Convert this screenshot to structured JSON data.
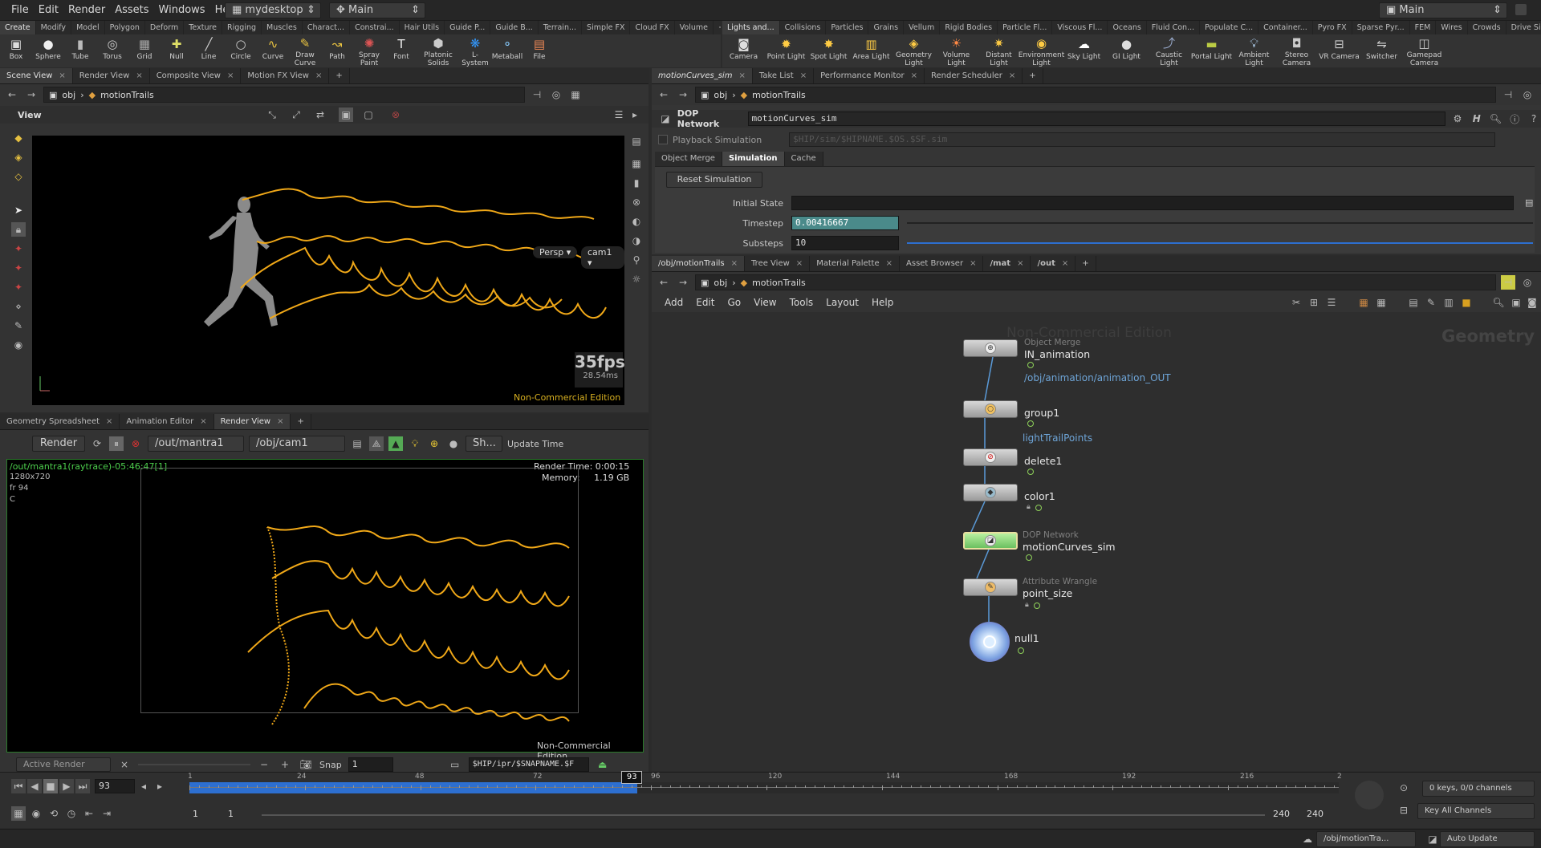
{
  "menubar": {
    "items": [
      "File",
      "Edit",
      "Render",
      "Assets",
      "Windows",
      "Help"
    ],
    "desktop": "mydesktop",
    "context": "Main",
    "right_context": "Main"
  },
  "shelf_left": {
    "tabs": [
      "Create",
      "Modify",
      "Model",
      "Polygon",
      "Deform",
      "Texture",
      "Rigging",
      "Muscles",
      "Charact...",
      "Constrai...",
      "Hair Utils",
      "Guide P...",
      "Guide B...",
      "Terrain...",
      "Simple FX",
      "Cloud FX",
      "Volume"
    ],
    "tools": [
      {
        "label": "Box",
        "icon": "box-icon"
      },
      {
        "label": "Sphere",
        "icon": "sphere-icon"
      },
      {
        "label": "Tube",
        "icon": "tube-icon"
      },
      {
        "label": "Torus",
        "icon": "torus-icon"
      },
      {
        "label": "Grid",
        "icon": "grid-icon"
      },
      {
        "label": "Null",
        "icon": "null-icon"
      },
      {
        "label": "Line",
        "icon": "line-icon"
      },
      {
        "label": "Circle",
        "icon": "circle-icon"
      },
      {
        "label": "Curve",
        "icon": "curve-icon"
      },
      {
        "label": "Draw Curve",
        "icon": "draw-curve-icon"
      },
      {
        "label": "Path",
        "icon": "path-icon"
      },
      {
        "label": "Spray Paint",
        "icon": "spray-paint-icon"
      },
      {
        "label": "Font",
        "icon": "font-icon"
      },
      {
        "label": "Platonic Solids",
        "icon": "platonic-icon"
      },
      {
        "label": "L-System",
        "icon": "lsystem-icon"
      },
      {
        "label": "Metaball",
        "icon": "metaball-icon"
      },
      {
        "label": "File",
        "icon": "file-icon"
      }
    ]
  },
  "shelf_right": {
    "tabs": [
      "Lights and...",
      "Collisions",
      "Particles",
      "Grains",
      "Vellum",
      "Rigid Bodies",
      "Particle Fl...",
      "Viscous Fl...",
      "Oceans",
      "Fluid Con...",
      "Populate C...",
      "Container...",
      "Pyro FX",
      "Sparse Pyr...",
      "FEM",
      "Wires",
      "Crowds",
      "Drive Sim..."
    ],
    "tools": [
      {
        "label": "Camera",
        "icon": "camera-icon"
      },
      {
        "label": "Point Light",
        "icon": "point-light-icon"
      },
      {
        "label": "Spot Light",
        "icon": "spot-light-icon"
      },
      {
        "label": "Area Light",
        "icon": "area-light-icon"
      },
      {
        "label": "Geometry Light",
        "icon": "geometry-light-icon"
      },
      {
        "label": "Volume Light",
        "icon": "volume-light-icon"
      },
      {
        "label": "Distant Light",
        "icon": "distant-light-icon"
      },
      {
        "label": "Environment Light",
        "icon": "environment-light-icon"
      },
      {
        "label": "Sky Light",
        "icon": "sky-light-icon"
      },
      {
        "label": "GI Light",
        "icon": "gi-light-icon"
      },
      {
        "label": "Caustic Light",
        "icon": "caustic-light-icon"
      },
      {
        "label": "Portal Light",
        "icon": "portal-light-icon"
      },
      {
        "label": "Ambient Light",
        "icon": "ambient-light-icon"
      },
      {
        "label": "Stereo Camera",
        "icon": "stereo-camera-icon"
      },
      {
        "label": "VR Camera",
        "icon": "vr-camera-icon"
      },
      {
        "label": "Switcher",
        "icon": "switcher-icon"
      },
      {
        "label": "Gamepad Camera",
        "icon": "gamepad-camera-icon"
      }
    ]
  },
  "scene_pane": {
    "tabs": [
      "Scene View",
      "Render View",
      "Composite View",
      "Motion FX View"
    ],
    "path_root": "obj",
    "path_node": "motionTrails",
    "view_label": "View",
    "persp": "Persp",
    "cam": "cam1",
    "fps": "35fps",
    "ms": "28.54ms",
    "watermark": "Non-Commercial Edition"
  },
  "render_pane": {
    "tabs": [
      "Geometry Spreadsheet",
      "Animation Editor",
      "Render View"
    ],
    "render_button": "Render",
    "output": "/out/mantra1",
    "camera": "/obj/cam1",
    "sh_button": "Sh...",
    "update_time": "Update Time",
    "info_title": "/out/mantra1(raytrace)-05:46:47[1]",
    "resolution": "1280x720",
    "frame": "fr 94",
    "channel": "C",
    "render_time_label": "Render Time:",
    "render_time": "0:00:15",
    "memory_label": "Memory:",
    "memory": "1.19 GB",
    "watermark": "Non-Commercial Edition",
    "active_render": "Active Render",
    "snap": "Snap",
    "snap_value": "1",
    "snapname": "$HIP/ipr/$SNAPNAME.$F"
  },
  "params_pane": {
    "tabs": [
      "motionCurves_sim",
      "Take List",
      "Performance Monitor",
      "Render Scheduler"
    ],
    "path_root": "obj",
    "path_node": "motionTrails",
    "op_type": "DOP Network",
    "op_name": "motionCurves_sim",
    "playback_label": "Playback Simulation",
    "playback_path": "$HIP/sim/$HIPNAME.$OS.$SF.sim",
    "subtabs": [
      "Object Merge",
      "Simulation",
      "Cache"
    ],
    "active_subtab": "Simulation",
    "reset_button": "Reset Simulation",
    "initial_state_label": "Initial State",
    "timestep_label": "Timestep",
    "timestep": "0.00416667",
    "substeps_label": "Substeps",
    "substeps": "10"
  },
  "network_pane": {
    "tabs": [
      "/obj/motionTrails",
      "Tree View",
      "Material Palette",
      "Asset Browser",
      "/mat",
      "/out"
    ],
    "path_root": "obj",
    "path_node": "motionTrails",
    "menu": [
      "Add",
      "Edit",
      "Go",
      "View",
      "Tools",
      "Layout",
      "Help"
    ],
    "watermark": "Non-Commercial Edition",
    "context_label": "Geometry",
    "nodes": [
      {
        "type": "Object Merge",
        "name": "IN_animation",
        "sub": "/obj/animation/animation_OUT"
      },
      {
        "type": "",
        "name": "group1",
        "sub": "lightTrailPoints"
      },
      {
        "type": "",
        "name": "delete1",
        "sub": ""
      },
      {
        "type": "",
        "name": "color1",
        "sub": ""
      },
      {
        "type": "DOP Network",
        "name": "motionCurves_sim",
        "sub": ""
      },
      {
        "type": "Attribute Wrangle",
        "name": "point_size",
        "sub": ""
      },
      {
        "type": "",
        "name": "null1",
        "sub": ""
      }
    ]
  },
  "timeline": {
    "current_frame": "93",
    "ticks": [
      "1",
      "24",
      "48",
      "72",
      "96",
      "120",
      "144",
      "168",
      "192",
      "216",
      "2"
    ],
    "start": "1",
    "start2": "1",
    "end": "240",
    "end2": "240",
    "keys_info": "0 keys, 0/0 channels",
    "key_all": "Key All Channels",
    "played_fraction": 0.39
  },
  "statusbar": {
    "path": "/obj/motionTra...",
    "auto_update": "Auto Update"
  },
  "colors": {
    "trail": "#f0a818",
    "selected_node": "#8fe07a",
    "accent_blue": "#2d6fd0"
  }
}
